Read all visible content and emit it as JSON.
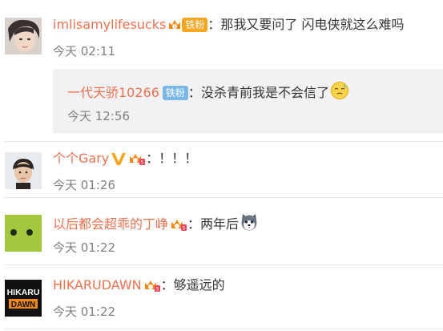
{
  "comments": [
    {
      "username": "imlisamylifesucks",
      "separator": "：",
      "text": "那我又要问了 闪电侠就这么难吗",
      "time": "今天 02:11",
      "badge": {
        "label": "铁粉",
        "color": "#f5a623"
      }
    },
    {
      "username": "个个Gary",
      "separator": "：",
      "text": "！！！",
      "time": "今天 01:26"
    },
    {
      "username": "以后都会超乖的丁峥",
      "separator": "：",
      "text": "两年后",
      "time": "今天 01:22"
    },
    {
      "username": "HIKARUDAWN",
      "separator": "：",
      "text": "够遥远的",
      "time": "今天 01:22"
    }
  ],
  "reply": {
    "username": "一代天骄10266",
    "separator": "：",
    "text": "没杀青前我是不会信了",
    "time": "今天 12:56",
    "badge": {
      "label": "铁粉",
      "color": "#7ab6e6"
    }
  },
  "avatars": {
    "hikaru_top": "HIKARU",
    "hikaru_bottom": "DAWN"
  },
  "colors": {
    "username": "#eb7350",
    "time": "#808080",
    "reply_background": "#f2f2f5",
    "verified_v": "#f7a51c",
    "level_badge": "#f08a1c"
  },
  "icons": [
    "crown-level-badge-icon",
    "verified-v-icon",
    "sweat-emoji-icon",
    "husky-emoji-icon"
  ]
}
